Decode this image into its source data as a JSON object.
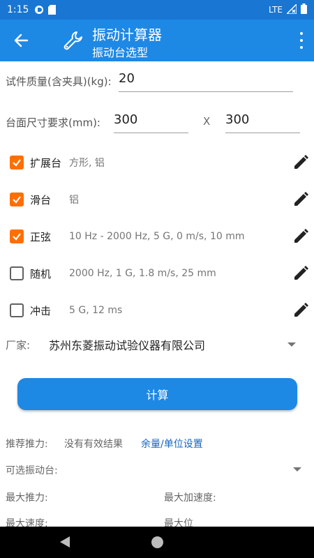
{
  "status_bar": {
    "time": "1:15",
    "network": "LTE"
  },
  "app_bar": {
    "title": "振动计算器",
    "subtitle": "振动台选型"
  },
  "mass": {
    "label": "试件质量(含夹具)(kg):",
    "value": "20"
  },
  "table_size": {
    "label": "台面尺寸要求(mm):",
    "width": "300",
    "separator": "X",
    "height": "300"
  },
  "options": [
    {
      "name": "扩展台",
      "desc": "方形, 铝",
      "checked": true
    },
    {
      "name": "滑台",
      "desc": "铝",
      "checked": true
    },
    {
      "name": "正弦",
      "desc": "10 Hz - 2000 Hz, 5 G, 0 m/s, 10 mm",
      "checked": true
    },
    {
      "name": "随机",
      "desc": "2000 Hz, 1 G, 1.8 m/s, 25 mm",
      "checked": false
    },
    {
      "name": "冲击",
      "desc": "5 G, 12 ms",
      "checked": false
    }
  ],
  "manufacturer": {
    "label": "厂家:",
    "value": "苏州东菱振动试验仪器有限公司"
  },
  "calculate_label": "计算",
  "results": {
    "recommended_label": "推荐推力:",
    "recommended_value": "没有有效结果",
    "margin_link": "余量/单位设置",
    "optional_label": "可选振动台:",
    "max_force_label": "最大推力:",
    "max_accel_label": "最大加速度:",
    "max_velocity_label": "最大速度:",
    "max_disp_label": "最大位"
  },
  "colors": {
    "app_bar": "#1e88e5",
    "status_bar": "#1976d2",
    "checkbox": "#ff6f00"
  },
  "icons": {
    "back": "arrow-left",
    "app": "wrench",
    "more": "vertical-dots",
    "edit": "pencil"
  }
}
